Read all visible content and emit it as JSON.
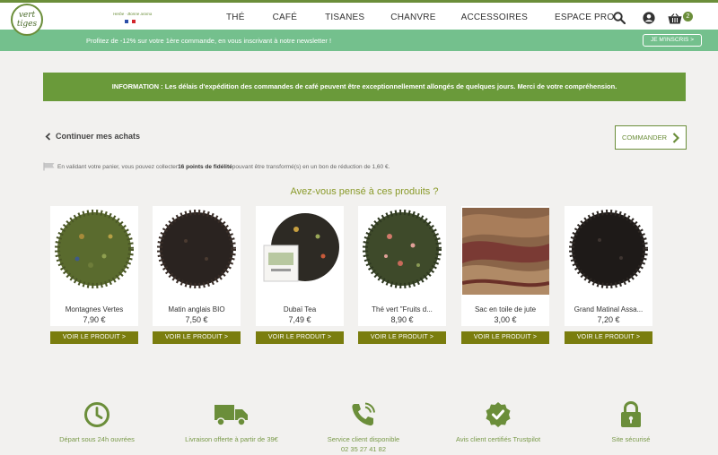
{
  "brand": {
    "logo_line1": "vert",
    "logo_line2": "tiges",
    "tagline": "Herbe · Bonne aroma"
  },
  "nav": [
    "THÉ",
    "CAFÉ",
    "TISANES",
    "CHANVRE",
    "ACCESSOIRES",
    "ESPACE PRO"
  ],
  "header_icons": [
    "search-icon",
    "account-icon",
    "cart-icon"
  ],
  "cart_count": "2",
  "promo": {
    "text": "Profitez de -12% sur votre 1ère commande, en vous inscrivant à notre newsletter !",
    "button": "JE M'INSCRIS >"
  },
  "info_banner": "INFORMATION : Les délais d'expédition des commandes de café peuvent être exceptionnellement allongés de quelques jours. Merci de votre compréhension.",
  "continue_label": "Continuer mes achats",
  "order_button": "COMMANDER",
  "loyalty": {
    "before": "En validant votre panier, vous pouvez collecter ",
    "points": "16 points de fidélité",
    "after": " pouvant être transformé(s) en un bon de réduction de 1,60 €."
  },
  "suggest_title": "Avez-vous pensé à ces produits ?",
  "products": [
    {
      "name": "Montagnes Vertes",
      "price": "7,90 €",
      "button": "VOIR LE PRODUIT >"
    },
    {
      "name": "Matin anglais BIO",
      "price": "7,50 €",
      "button": "VOIR LE PRODUIT >"
    },
    {
      "name": "Dubaï Tea",
      "price": "7,49 €",
      "button": "VOIR LE PRODUIT >"
    },
    {
      "name": "Thé vert \"Fruits d...",
      "price": "8,90 €",
      "button": "VOIR LE PRODUIT >"
    },
    {
      "name": "Sac en toile de jute",
      "price": "3,00 €",
      "button": "VOIR LE PRODUIT >"
    },
    {
      "name": "Grand Matinal Assa...",
      "price": "7,20 €",
      "button": "VOIR LE PRODUIT >"
    }
  ],
  "features": [
    {
      "label": "Départ sous 24h ouvrées",
      "icon": "clock-icon"
    },
    {
      "label": "Livraison offerte à partir de 39€",
      "icon": "truck-icon"
    },
    {
      "label": "Service client disponible",
      "label2": "02 35 27 41 82",
      "icon": "phone-icon"
    },
    {
      "label": "Avis client certifiés Trustpilot",
      "icon": "badge-check-icon"
    },
    {
      "label": "Site sécurisé",
      "icon": "lock-icon"
    }
  ],
  "colors": {
    "brand_green": "#6b8e3a",
    "promo_green": "#74c08d",
    "info_green": "#6a9a3a",
    "product_button": "#7a7d0e"
  }
}
